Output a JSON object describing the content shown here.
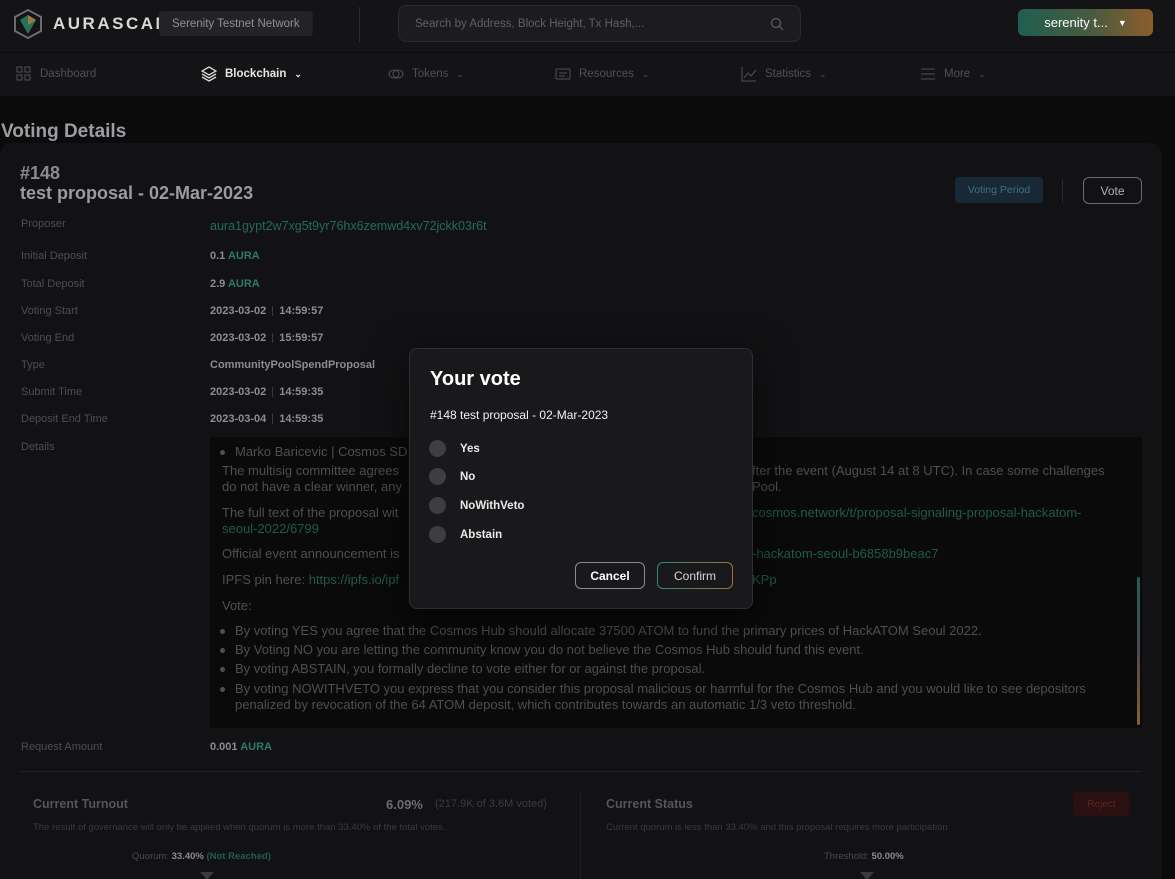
{
  "header": {
    "logo_text": "AURASCAN",
    "network": "Serenity Testnet Network",
    "search_placeholder": "Search by Address, Block Height, Tx Hash,...",
    "wallet_label": "serenity t..."
  },
  "nav": [
    {
      "label": "Dashboard",
      "icon": "grid-icon"
    },
    {
      "label": "Blockchain",
      "icon": "layers-icon"
    },
    {
      "label": "Tokens",
      "icon": "coins-icon"
    },
    {
      "label": "Resources",
      "icon": "card-icon"
    },
    {
      "label": "Statistics",
      "icon": "chart-icon"
    },
    {
      "label": "More",
      "icon": "menu-icon"
    }
  ],
  "page_title": "Voting Details",
  "proposal": {
    "id": "#148",
    "title": "test proposal - 02-Mar-2023",
    "status": "Voting Period",
    "vote_button": "Vote",
    "fields": {
      "proposer_label": "Proposer",
      "proposer": "aura1gypt2w7xg5t9yr76hx6zemwd4xv72jckk03r6t",
      "initial_deposit_label": "Initial Deposit",
      "initial_deposit": "0.1",
      "total_deposit_label": "Total Deposit",
      "total_deposit": "2.9",
      "denom": "AURA",
      "voting_start_label": "Voting Start",
      "voting_start_date": "2023-03-02",
      "voting_start_time": "14:59:57",
      "voting_end_label": "Voting End",
      "voting_end_date": "2023-03-02",
      "voting_end_time": "15:59:57",
      "type_label": "Type",
      "type": "CommunityPoolSpendProposal",
      "submit_time_label": "Submit Time",
      "submit_date": "2023-03-02",
      "submit_time": "14:59:35",
      "deposit_end_label": "Deposit End Time",
      "deposit_end_date": "2023-03-04",
      "deposit_end_time": "14:59:35",
      "details_label": "Details",
      "request_amount_label": "Request Amount",
      "request_amount": "0.001"
    },
    "details": {
      "line1": "Marko Baricevic | Cosmos SD",
      "p1a": "The multisig committee agrees",
      "p1b": "fter the event (August 14 at 8 UTC). In case some challenges",
      "p1c": "do not have a clear winner, any",
      "p1d": "Pool.",
      "p2a": "The full text of the proposal wit",
      "p2b": "cosmos.network/t/proposal-signaling-proposal-hackatom-",
      "p2c": "seoul-2022/6799",
      "p3a": "Official event announcement is",
      "p3b": "-hackatom-seoul-b6858b9beac7",
      "p4a": "IPFS pin here: ",
      "p4b": "https://ipfs.io/ipf",
      "p4c": "KPp",
      "vote_heading": "Vote:",
      "b1": "By voting YES you agree that the Cosmos Hub should allocate 37500 ATOM to fund the primary prices of HackATOM Seoul 2022.",
      "b2": "By Voting NO you are letting the community know you do not believe the Cosmos Hub should fund this event.",
      "b3": "By voting ABSTAIN, you formally decline to vote either for or against the proposal.",
      "b4a": "By voting NOWITHVETO you express that you consider this proposal malicious or harmful for the Cosmos Hub and you would like to see depositors",
      "b4b": "penalized by revocation of the 64 ATOM deposit, which contributes towards an automatic 1/3 veto threshold."
    }
  },
  "turnout": {
    "title": "Current Turnout",
    "percent": "6.09%",
    "voted": "(217.9K of 3.6M voted)",
    "subtitle": "The result of governance will only be applied when quorum is more than 33.40% of the total votes.",
    "quorum_label": "Quorum:",
    "quorum_value": "33.40%",
    "quorum_state": "(Not Reached)"
  },
  "status_panel": {
    "title": "Current Status",
    "badge": "Reject",
    "subtitle": "Current quorum is less than 33.40% and this proposal requires more participation",
    "threshold_label": "Threshold:",
    "threshold_value": "50.00%"
  },
  "modal": {
    "title": "Your vote",
    "subtitle": "#148 test proposal - 02-Mar-2023",
    "options": [
      "Yes",
      "No",
      "NoWithVeto",
      "Abstain"
    ],
    "cancel": "Cancel",
    "confirm": "Confirm"
  },
  "colors": {
    "accent_green": "#236b58",
    "accent_orange": "#8d5d2b",
    "background": "#0b0b0c"
  }
}
